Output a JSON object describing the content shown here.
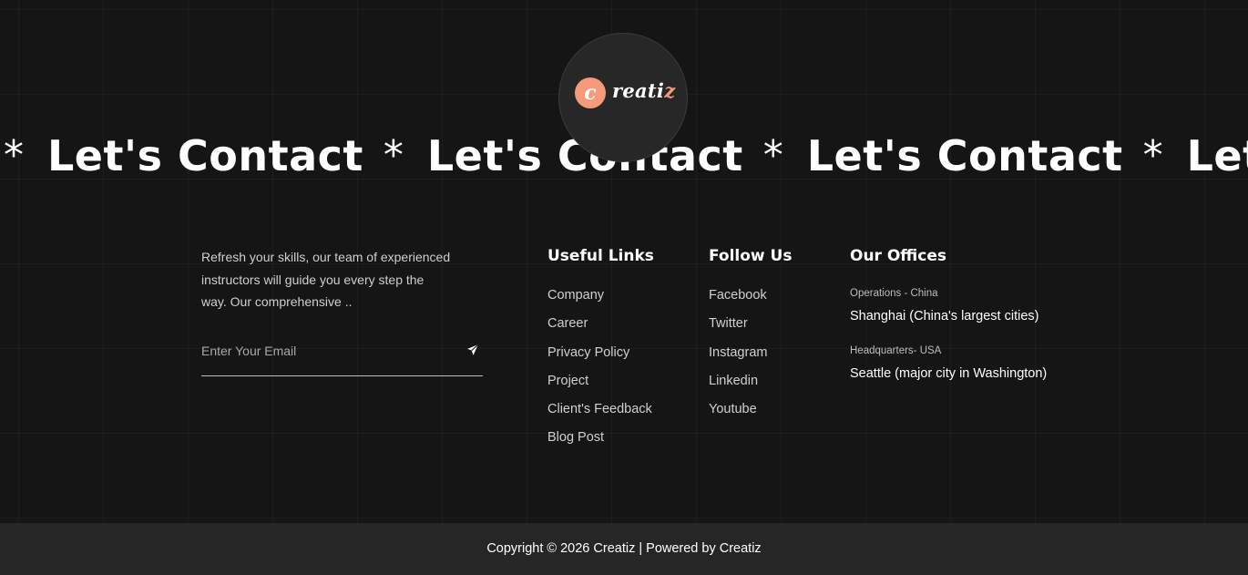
{
  "marquee": {
    "star": "*",
    "text": "Let's Contact"
  },
  "logo": {
    "mark": "c",
    "word_main": "reati",
    "word_accent": "z",
    "accent_color": "#f59a7a"
  },
  "about": {
    "text_line1": "Refresh your skills, our team of experienced",
    "text_line2": "instructors will guide you every step the",
    "text_line3": "way. Our comprehensive .."
  },
  "newsletter": {
    "placeholder": "Enter Your Email",
    "value": "",
    "send_icon": "paper-plane-icon"
  },
  "useful_links": {
    "title": "Useful Links",
    "items": [
      "Company",
      "Career",
      "Privacy Policy",
      "Project",
      "Client's Feedback",
      "Blog Post"
    ]
  },
  "follow_us": {
    "title": "Follow Us",
    "items": [
      "Facebook",
      "Twitter",
      "Instagram",
      "Linkedin",
      "Youtube"
    ]
  },
  "offices": {
    "title": "Our Offices",
    "list": [
      {
        "label": "Operations - China",
        "city": "Shanghai (China's largest cities)"
      },
      {
        "label": "Headquarters- USA",
        "city": "Seattle (major city in Washington)"
      }
    ]
  },
  "footer": {
    "copyright": "Copyright © 2026 Creatiz | Powered by Creatiz"
  },
  "colors": {
    "background": "#151515",
    "bottom_bar": "#262626",
    "accent": "#f59a7a"
  }
}
